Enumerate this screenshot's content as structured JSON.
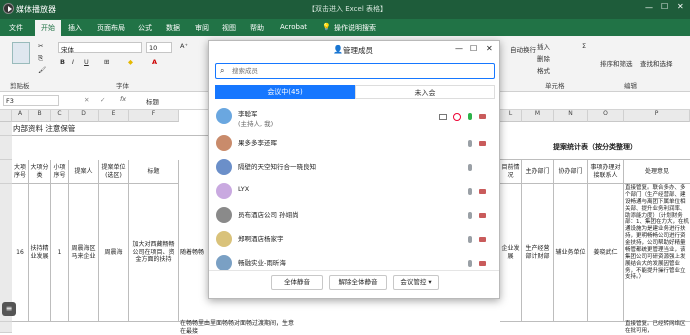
{
  "titlebar": {
    "app_title": "媒体播放器",
    "center_text": "【双击进入 Excel 表格】"
  },
  "menu": {
    "tabs": [
      "文件",
      "开始",
      "插入",
      "页面布局",
      "公式",
      "数据",
      "审阅",
      "视图",
      "帮助",
      "Acrobat",
      "操作说明搜索"
    ]
  },
  "ribbon": {
    "font_name": "宋体",
    "font_size": "10",
    "groups": {
      "clipboard": "剪贴板",
      "font": "字体",
      "cells": "单元格",
      "editing": "编辑"
    },
    "cells_buttons": [
      "插入",
      "删除",
      "格式"
    ],
    "edit_buttons": [
      "排序和筛选",
      "查找和选择"
    ],
    "wrap_label": "自动换行"
  },
  "formula_bar": {
    "name_box": "F3",
    "content": "标题"
  },
  "sheet": {
    "col_letters": [
      "A",
      "B",
      "C",
      "D",
      "E",
      "F",
      "G",
      "H",
      "I",
      "J",
      "K",
      "L",
      "M",
      "N",
      "O",
      "P"
    ],
    "title_row": "内部资料  注意保管",
    "report_title": "提案统计表（按分类整理）",
    "headers": [
      "大项序号",
      "大项分类",
      "小项序号",
      "提案人",
      "提案单位(选区)",
      "标题",
      "",
      "",
      "",
      "",
      "",
      "目前情况",
      "主办部门",
      "协办部门",
      "事项办理对接联系人",
      "处理意见"
    ],
    "row": {
      "big_no": "16",
      "category": "扶持精业发展",
      "small_no": "1",
      "proposer": "周晨海",
      "unit": "周晨海区马来企业",
      "title": "加大对西藏畅畅公司在项目、资金方面的扶持",
      "title2": "随着畅畅",
      "status": "企业发展",
      "main_dept": "生产经营部计财部",
      "assist_dept": "辅业务单位",
      "contact": "姜晓武仁",
      "opinion": "直接管复。联合多办、多个部门（生产经营部、建设畅通与离团下属单位相关部、提升业务利润率、助添能力度）（计划财务部：1、集团在力大，在机通设施为是建业务进行扶持，更明畅畅公司进行资金扶持，公司帮助好精量畅管都统更管理当业，该集团公司可研资源强上发展结合大的发展因管业务，不能提升操行管业立支持。）"
    },
    "row2_text": "在畅畅里由里面畅畅对面畅过渡期间，生意在最接",
    "row2_opinion": "直接管复。已经转网络区在批可用，"
  },
  "dialog": {
    "title": "管理成员",
    "search_placeholder": "搜索成员",
    "tab_in_meeting": "会议中(45)",
    "tab_not_in": "未入会",
    "members": [
      {
        "name": "李聪军",
        "sub": "(主持人, 我)",
        "color": "#6aa7e0"
      },
      {
        "name": "果多多李还晖",
        "sub": "",
        "color": "#c98b6b"
      },
      {
        "name": "隔壁的天空知行合一晓良知",
        "sub": "",
        "color": "#6b8fc9"
      },
      {
        "name": "LYX",
        "sub": "",
        "color": "#c9a9e0"
      },
      {
        "name": "员布酒店公司  孙翊尚",
        "sub": "",
        "color": "#8a8a8a"
      },
      {
        "name": "郑啊酒店杨家宇",
        "sub": "",
        "color": "#d9c27a"
      },
      {
        "name": "畅融实业-雨昕海",
        "sub": "",
        "color": "#7aa0c4"
      }
    ],
    "buttons": {
      "mute_all": "全体静音",
      "unmute_all": "解除全体静音",
      "meeting_control": "会议管控"
    }
  }
}
